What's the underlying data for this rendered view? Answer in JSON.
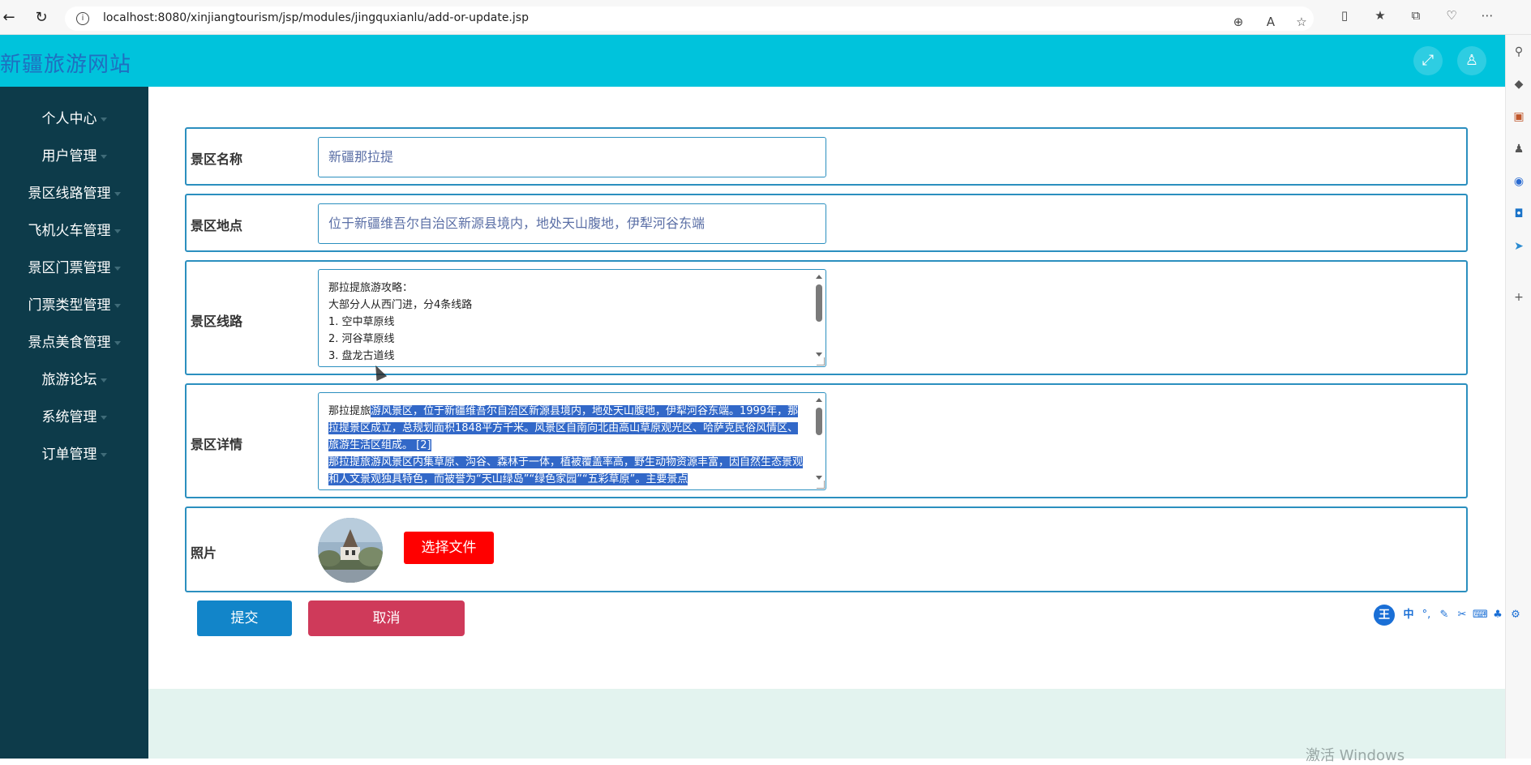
{
  "browser": {
    "url": "localhost:8080/xinjiangtourism/jsp/modules/jingquxianlu/add-or-update.jsp",
    "back_icon": "back-arrow-icon",
    "refresh_icon": "refresh-icon"
  },
  "app": {
    "title": "新疆旅游网站",
    "header_color": "#00c3dc",
    "sidebar_color": "#0d3b4a"
  },
  "sidebar": {
    "items": [
      {
        "label": "个人中心"
      },
      {
        "label": "用户管理"
      },
      {
        "label": "景区线路管理"
      },
      {
        "label": "飞机火车管理"
      },
      {
        "label": "景区门票管理"
      },
      {
        "label": "门票类型管理"
      },
      {
        "label": "景点美食管理"
      },
      {
        "label": "旅游论坛"
      },
      {
        "label": "系统管理"
      },
      {
        "label": "订单管理"
      }
    ]
  },
  "form": {
    "name": {
      "label": "景区名称",
      "value": "新疆那拉提"
    },
    "location": {
      "label": "景区地点",
      "value": "位于新疆维吾尔自治区新源县境内，地处天山腹地，伊犁河谷东端"
    },
    "route": {
      "label": "景区线路",
      "lines": [
        "那拉提旅游攻略：",
        "大部分人从西门进，分4条线路",
        "1. 空中草原线",
        "2. 河谷草原线",
        "3. 盘龙古道线"
      ]
    },
    "detail": {
      "label": "景区详情",
      "text_plain_prefix": "那拉提旅",
      "text_selected": "游风景区，位于新疆维吾尔自治区新源县境内，地处天山腹地，伊犁河谷东端。1999年，那拉提景区成立，总规划面积1848平方千米。风景区自南向北由高山草原观光区、哈萨克民俗风情区、旅游生活区组成。 [2]\n那拉提旅游风景区内集草原、沟谷、森林于一体，植被覆盖率高，野生动物资源丰富，因自然生态景观和人文景观独具特色，而被誉为“天山绿岛”“绿色家园”“五彩草原”。主要景点"
    },
    "photo": {
      "label": "照片",
      "choose_label": "选择文件",
      "choose_color": "#ff0000"
    }
  },
  "actions": {
    "submit_label": "提交",
    "submit_color": "#1285c9",
    "cancel_label": "取消",
    "cancel_color": "#cf3a5a"
  },
  "watermark": "激活 Windows",
  "ime": {
    "logo": "王",
    "mode": "中"
  }
}
